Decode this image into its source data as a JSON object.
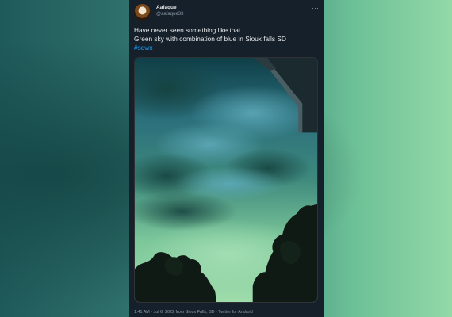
{
  "tweet": {
    "author_name": "Aafaque",
    "author_handle": "@aafaque33",
    "more_icon": "more-horizontal-icon",
    "text_lines": [
      "Have never seen something like that.",
      "Green sky with combination of blue in Sioux falls SD"
    ],
    "hashtag": "#sdwx",
    "timestamp": "1:41 AM · Jul 6, 2022 from Sioux Falls, SD · Twitter for Android"
  },
  "colors": {
    "tweet_background": "#15202b",
    "link": "#1d9bf0",
    "sky_green": "#5fae82",
    "sky_teal": "#2f7f8a"
  }
}
